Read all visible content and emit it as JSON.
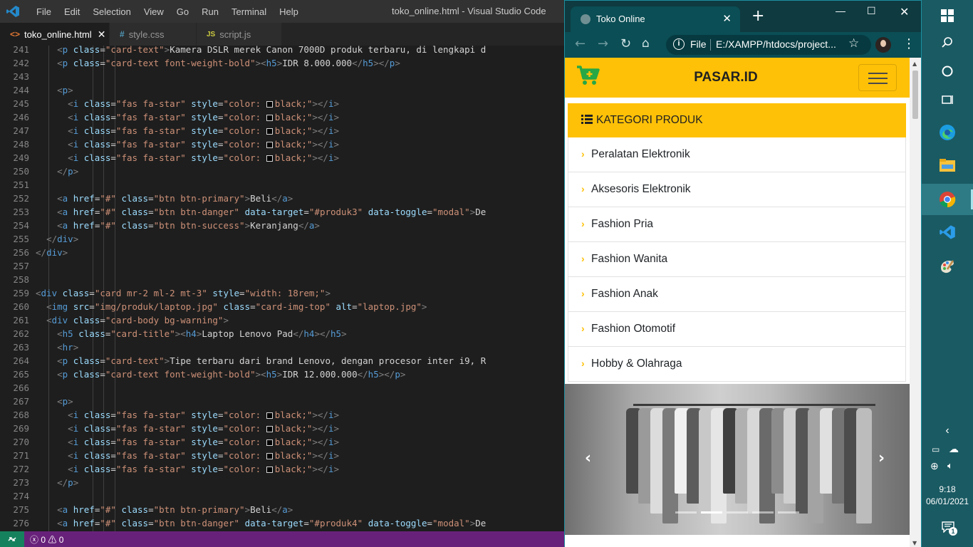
{
  "vscode": {
    "menu": [
      "File",
      "Edit",
      "Selection",
      "View",
      "Go",
      "Run",
      "Terminal",
      "Help"
    ],
    "window_title": "toko_online.html - Visual Studio Code",
    "tabs": [
      {
        "label": "toko_online.html",
        "icon": "<>",
        "icon_color": "#e37933",
        "active": true
      },
      {
        "label": "style.css",
        "icon": "#",
        "icon_color": "#519aba",
        "active": false
      },
      {
        "label": "script.js",
        "icon": "JS",
        "icon_color": "#cbcb41",
        "active": false
      }
    ],
    "lines": [
      {
        "n": "241",
        "code": [
          [
            "tx",
            "    "
          ],
          [
            "tg",
            "<"
          ],
          [
            "tn",
            "p"
          ],
          [
            "tx",
            " "
          ],
          [
            "at",
            "class"
          ],
          [
            "tx",
            "="
          ],
          [
            "st",
            "\"card-text\""
          ],
          [
            "tg",
            ">"
          ],
          [
            "tx",
            "Kamera DSLR merek Canon 7000D produk terbaru, di lengkapi d"
          ]
        ]
      },
      {
        "n": "242",
        "code": [
          [
            "tx",
            "    "
          ],
          [
            "tg",
            "<"
          ],
          [
            "tn",
            "p"
          ],
          [
            "tx",
            " "
          ],
          [
            "at",
            "class"
          ],
          [
            "tx",
            "="
          ],
          [
            "st",
            "\"card-text font-weight-bold\""
          ],
          [
            "tg",
            "><"
          ],
          [
            "tn",
            "h5"
          ],
          [
            "tg",
            ">"
          ],
          [
            "tx",
            "IDR 8.000.000"
          ],
          [
            "tg",
            "</"
          ],
          [
            "tn",
            "h5"
          ],
          [
            "tg",
            "></"
          ],
          [
            "tn",
            "p"
          ],
          [
            "tg",
            ">"
          ]
        ]
      },
      {
        "n": "243",
        "code": []
      },
      {
        "n": "244",
        "code": [
          [
            "tx",
            "    "
          ],
          [
            "tg",
            "<"
          ],
          [
            "tn",
            "p"
          ],
          [
            "tg",
            ">"
          ]
        ]
      },
      {
        "n": "245",
        "star": true
      },
      {
        "n": "246",
        "star": true
      },
      {
        "n": "247",
        "star": true
      },
      {
        "n": "248",
        "star": true
      },
      {
        "n": "249",
        "star": true
      },
      {
        "n": "250",
        "code": [
          [
            "tx",
            "    "
          ],
          [
            "tg",
            "</"
          ],
          [
            "tn",
            "p"
          ],
          [
            "tg",
            ">"
          ]
        ]
      },
      {
        "n": "251",
        "code": []
      },
      {
        "n": "252",
        "code": [
          [
            "tx",
            "    "
          ],
          [
            "tg",
            "<"
          ],
          [
            "tn",
            "a"
          ],
          [
            "tx",
            " "
          ],
          [
            "at",
            "href"
          ],
          [
            "tx",
            "="
          ],
          [
            "st",
            "\"#\""
          ],
          [
            "tx",
            " "
          ],
          [
            "at",
            "class"
          ],
          [
            "tx",
            "="
          ],
          [
            "st",
            "\"btn btn-primary\""
          ],
          [
            "tg",
            ">"
          ],
          [
            "tx",
            "Beli"
          ],
          [
            "tg",
            "</"
          ],
          [
            "tn",
            "a"
          ],
          [
            "tg",
            ">"
          ]
        ]
      },
      {
        "n": "253",
        "code": [
          [
            "tx",
            "    "
          ],
          [
            "tg",
            "<"
          ],
          [
            "tn",
            "a"
          ],
          [
            "tx",
            " "
          ],
          [
            "at",
            "href"
          ],
          [
            "tx",
            "="
          ],
          [
            "st",
            "\"#\""
          ],
          [
            "tx",
            " "
          ],
          [
            "at",
            "class"
          ],
          [
            "tx",
            "="
          ],
          [
            "st",
            "\"btn btn-danger\""
          ],
          [
            "tx",
            " "
          ],
          [
            "at",
            "data-target"
          ],
          [
            "tx",
            "="
          ],
          [
            "st",
            "\"#produk3\""
          ],
          [
            "tx",
            " "
          ],
          [
            "at",
            "data-toggle"
          ],
          [
            "tx",
            "="
          ],
          [
            "st",
            "\"modal\""
          ],
          [
            "tg",
            ">"
          ],
          [
            "tx",
            "De"
          ]
        ]
      },
      {
        "n": "254",
        "code": [
          [
            "tx",
            "    "
          ],
          [
            "tg",
            "<"
          ],
          [
            "tn",
            "a"
          ],
          [
            "tx",
            " "
          ],
          [
            "at",
            "href"
          ],
          [
            "tx",
            "="
          ],
          [
            "st",
            "\"#\""
          ],
          [
            "tx",
            " "
          ],
          [
            "at",
            "class"
          ],
          [
            "tx",
            "="
          ],
          [
            "st",
            "\"btn btn-success\""
          ],
          [
            "tg",
            ">"
          ],
          [
            "tx",
            "Keranjang"
          ],
          [
            "tg",
            "</"
          ],
          [
            "tn",
            "a"
          ],
          [
            "tg",
            ">"
          ]
        ]
      },
      {
        "n": "255",
        "code": [
          [
            "tx",
            "  "
          ],
          [
            "tg",
            "</"
          ],
          [
            "tn",
            "div"
          ],
          [
            "tg",
            ">"
          ]
        ]
      },
      {
        "n": "256",
        "code": [
          [
            "tg",
            "</"
          ],
          [
            "tn",
            "div"
          ],
          [
            "tg",
            ">"
          ]
        ]
      },
      {
        "n": "257",
        "code": []
      },
      {
        "n": "258",
        "code": []
      },
      {
        "n": "259",
        "code": [
          [
            "tg",
            "<"
          ],
          [
            "tn",
            "div"
          ],
          [
            "tx",
            " "
          ],
          [
            "at",
            "class"
          ],
          [
            "tx",
            "="
          ],
          [
            "st",
            "\"card mr-2 ml-2 mt-3\""
          ],
          [
            "tx",
            " "
          ],
          [
            "at",
            "style"
          ],
          [
            "tx",
            "="
          ],
          [
            "st",
            "\"width: 18rem;\""
          ],
          [
            "tg",
            ">"
          ]
        ]
      },
      {
        "n": "260",
        "code": [
          [
            "tx",
            "  "
          ],
          [
            "tg",
            "<"
          ],
          [
            "tn",
            "img"
          ],
          [
            "tx",
            " "
          ],
          [
            "at",
            "src"
          ],
          [
            "tx",
            "="
          ],
          [
            "st",
            "\"img/produk/laptop.jpg\""
          ],
          [
            "tx",
            " "
          ],
          [
            "at",
            "class"
          ],
          [
            "tx",
            "="
          ],
          [
            "st",
            "\"card-img-top\""
          ],
          [
            "tx",
            " "
          ],
          [
            "at",
            "alt"
          ],
          [
            "tx",
            "="
          ],
          [
            "st",
            "\"laptop.jpg\""
          ],
          [
            "tg",
            ">"
          ]
        ]
      },
      {
        "n": "261",
        "code": [
          [
            "tx",
            "  "
          ],
          [
            "tg",
            "<"
          ],
          [
            "tn",
            "div"
          ],
          [
            "tx",
            " "
          ],
          [
            "at",
            "class"
          ],
          [
            "tx",
            "="
          ],
          [
            "st",
            "\"card-body bg-warning\""
          ],
          [
            "tg",
            ">"
          ]
        ]
      },
      {
        "n": "262",
        "code": [
          [
            "tx",
            "    "
          ],
          [
            "tg",
            "<"
          ],
          [
            "tn",
            "h5"
          ],
          [
            "tx",
            " "
          ],
          [
            "at",
            "class"
          ],
          [
            "tx",
            "="
          ],
          [
            "st",
            "\"card-title\""
          ],
          [
            "tg",
            "><"
          ],
          [
            "tn",
            "h4"
          ],
          [
            "tg",
            ">"
          ],
          [
            "tx",
            "Laptop Lenovo Pad"
          ],
          [
            "tg",
            "</"
          ],
          [
            "tn",
            "h4"
          ],
          [
            "tg",
            "></"
          ],
          [
            "tn",
            "h5"
          ],
          [
            "tg",
            ">"
          ]
        ]
      },
      {
        "n": "263",
        "code": [
          [
            "tx",
            "    "
          ],
          [
            "tg",
            "<"
          ],
          [
            "tn",
            "hr"
          ],
          [
            "tg",
            ">"
          ]
        ]
      },
      {
        "n": "264",
        "code": [
          [
            "tx",
            "    "
          ],
          [
            "tg",
            "<"
          ],
          [
            "tn",
            "p"
          ],
          [
            "tx",
            " "
          ],
          [
            "at",
            "class"
          ],
          [
            "tx",
            "="
          ],
          [
            "st",
            "\"card-text\""
          ],
          [
            "tg",
            ">"
          ],
          [
            "tx",
            "Tipe terbaru dari brand Lenovo, dengan procesor inter i9, R"
          ]
        ]
      },
      {
        "n": "265",
        "code": [
          [
            "tx",
            "    "
          ],
          [
            "tg",
            "<"
          ],
          [
            "tn",
            "p"
          ],
          [
            "tx",
            " "
          ],
          [
            "at",
            "class"
          ],
          [
            "tx",
            "="
          ],
          [
            "st",
            "\"card-text font-weight-bold\""
          ],
          [
            "tg",
            "><"
          ],
          [
            "tn",
            "h5"
          ],
          [
            "tg",
            ">"
          ],
          [
            "tx",
            "IDR 12.000.000"
          ],
          [
            "tg",
            "</"
          ],
          [
            "tn",
            "h5"
          ],
          [
            "tg",
            "></"
          ],
          [
            "tn",
            "p"
          ],
          [
            "tg",
            ">"
          ]
        ]
      },
      {
        "n": "266",
        "code": []
      },
      {
        "n": "267",
        "code": [
          [
            "tx",
            "    "
          ],
          [
            "tg",
            "<"
          ],
          [
            "tn",
            "p"
          ],
          [
            "tg",
            ">"
          ]
        ]
      },
      {
        "n": "268",
        "star": true
      },
      {
        "n": "269",
        "star": true
      },
      {
        "n": "270",
        "star": true
      },
      {
        "n": "271",
        "star": true
      },
      {
        "n": "272",
        "star": true
      },
      {
        "n": "273",
        "code": [
          [
            "tx",
            "    "
          ],
          [
            "tg",
            "</"
          ],
          [
            "tn",
            "p"
          ],
          [
            "tg",
            ">"
          ]
        ]
      },
      {
        "n": "274",
        "code": []
      },
      {
        "n": "275",
        "code": [
          [
            "tx",
            "    "
          ],
          [
            "tg",
            "<"
          ],
          [
            "tn",
            "a"
          ],
          [
            "tx",
            " "
          ],
          [
            "at",
            "href"
          ],
          [
            "tx",
            "="
          ],
          [
            "st",
            "\"#\""
          ],
          [
            "tx",
            " "
          ],
          [
            "at",
            "class"
          ],
          [
            "tx",
            "="
          ],
          [
            "st",
            "\"btn btn-primary\""
          ],
          [
            "tg",
            ">"
          ],
          [
            "tx",
            "Beli"
          ],
          [
            "tg",
            "</"
          ],
          [
            "tn",
            "a"
          ],
          [
            "tg",
            ">"
          ]
        ]
      },
      {
        "n": "276",
        "code": [
          [
            "tx",
            "    "
          ],
          [
            "tg",
            "<"
          ],
          [
            "tn",
            "a"
          ],
          [
            "tx",
            " "
          ],
          [
            "at",
            "href"
          ],
          [
            "tx",
            "="
          ],
          [
            "st",
            "\"#\""
          ],
          [
            "tx",
            " "
          ],
          [
            "at",
            "class"
          ],
          [
            "tx",
            "="
          ],
          [
            "st",
            "\"btn btn-danger\""
          ],
          [
            "tx",
            " "
          ],
          [
            "at",
            "data-target"
          ],
          [
            "tx",
            "="
          ],
          [
            "st",
            "\"#produk4\""
          ],
          [
            "tx",
            " "
          ],
          [
            "at",
            "data-toggle"
          ],
          [
            "tx",
            "="
          ],
          [
            "st",
            "\"modal\""
          ],
          [
            "tg",
            ">"
          ],
          [
            "tx",
            "De"
          ]
        ]
      }
    ],
    "star_line": [
      [
        "tx",
        "      "
      ],
      [
        "tg",
        "<"
      ],
      [
        "tn",
        "i"
      ],
      [
        "tx",
        " "
      ],
      [
        "at",
        "class"
      ],
      [
        "tx",
        "="
      ],
      [
        "st",
        "\"fas fa-star\""
      ],
      [
        "tx",
        " "
      ],
      [
        "at",
        "style"
      ],
      [
        "tx",
        "="
      ],
      [
        "st",
        "\"color: "
      ],
      [
        "box",
        ""
      ],
      [
        "st",
        "black;\""
      ],
      [
        "tg",
        "></"
      ],
      [
        "tn",
        "i"
      ],
      [
        "tg",
        ">"
      ]
    ],
    "status": {
      "errors": "0",
      "warnings": "0"
    },
    "colors": {
      "status_bar": "#68217a",
      "remote": "#16825d"
    }
  },
  "browser": {
    "tab_title": "Toko Online",
    "omnibox": {
      "scheme_label": "File",
      "url": "E:/XAMPP/htdocs/project..."
    },
    "site": {
      "brand": "PASAR.ID",
      "category_header": "KATEGORI PRODUK",
      "categories": [
        "Peralatan Elektronik",
        "Aksesoris Elektronik",
        "Fashion Pria",
        "Fashion Wanita",
        "Fashion Anak",
        "Fashion Otomotif",
        "Hobby & Olahraga"
      ],
      "carousel": {
        "indicators": 5,
        "active_index": 1
      },
      "accent": "#ffc107",
      "cart_color": "#28a745"
    }
  },
  "taskbar": {
    "apps": [
      "start-icon",
      "search-icon",
      "cortana-icon",
      "task-view-icon",
      "edge-icon",
      "file-explorer-icon",
      "chrome-icon",
      "vscode-icon",
      "paint-icon"
    ],
    "time": "9:18",
    "date": "06/01/2021",
    "notification_count": "1"
  }
}
